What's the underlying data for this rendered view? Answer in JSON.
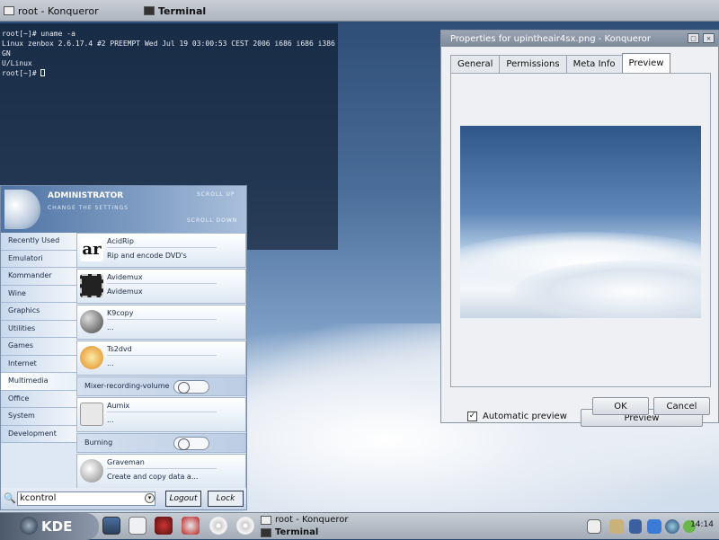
{
  "top_bar": {
    "task1": "root - Konqueror",
    "task2": "Terminal"
  },
  "terminal": {
    "lines": [
      "root[~]# uname -a",
      "Linux zenbox 2.6.17.4 #2 PREEMPT Wed Jul 19 03:00:53 CEST 2006 i686 i686 i386 GN",
      "U/Linux",
      "root[~]# "
    ]
  },
  "dialog": {
    "title": "Properties for upintheair4sx.png - Konqueror",
    "tabs": [
      "General",
      "Permissions",
      "Meta Info",
      "Preview"
    ],
    "auto_preview": "Automatic preview",
    "preview_btn": "Preview",
    "ok": "OK",
    "cancel": "Cancel"
  },
  "kmenu": {
    "user": "ADMINISTRATOR",
    "subtitle": "CHANGE THE SETTINGS",
    "scroll_up": "SCROLL UP",
    "scroll_down": "SCROLL DOWN",
    "categories": [
      "Recently Used",
      "Emulatori",
      "Kommander",
      "Wine",
      "Graphics",
      "Utilities",
      "Games",
      "Internet",
      "Multimedia",
      "Office",
      "System",
      "Development"
    ],
    "apps": [
      {
        "name": "AcidRip",
        "desc": "Rip and encode DVD's"
      },
      {
        "name": "Avidemux",
        "desc": "Avidemux"
      },
      {
        "name": "K9copy",
        "desc": "..."
      },
      {
        "name": "Ts2dvd",
        "desc": "..."
      },
      {
        "name": "Mixer-recording-volume"
      },
      {
        "name": "Aumix",
        "desc": "..."
      },
      {
        "name": "Burning"
      },
      {
        "name": "Graveman",
        "desc": "Create and copy data a..."
      }
    ],
    "search_value": "kcontrol",
    "logout": "Logout",
    "lock": "Lock"
  },
  "panel": {
    "kde": "KDE",
    "task1": "root - Konqueror",
    "task2": "Terminal",
    "clock": "14:14"
  }
}
